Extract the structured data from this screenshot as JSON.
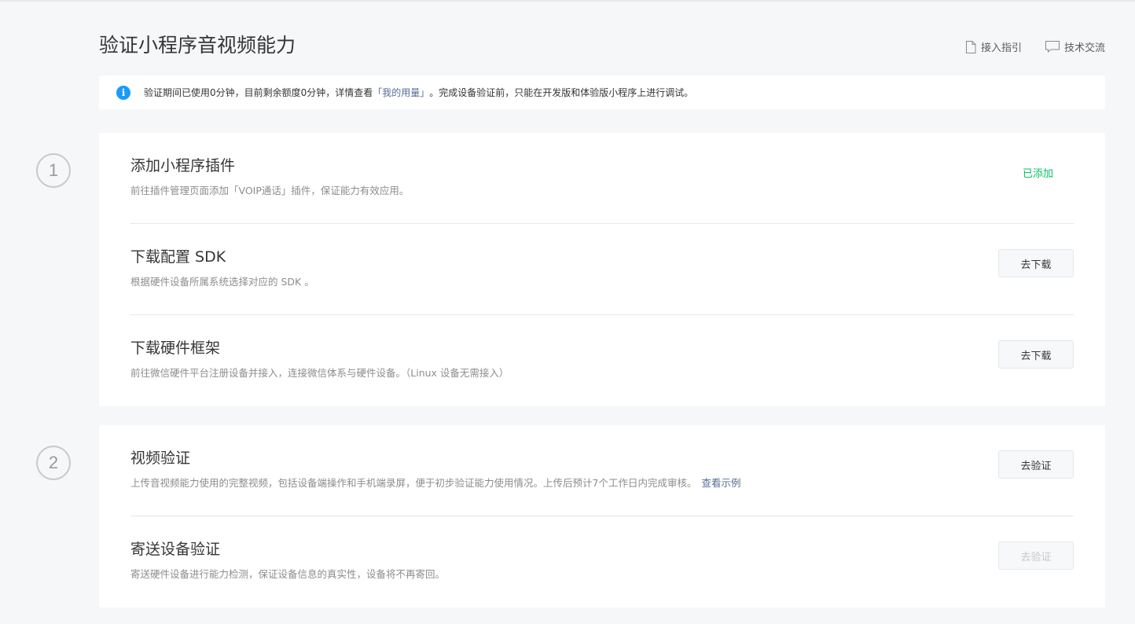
{
  "page": {
    "title": "验证小程序音视频能力"
  },
  "header_links": [
    {
      "label": "接入指引",
      "icon": "document-icon"
    },
    {
      "label": "技术交流",
      "icon": "chat-icon"
    }
  ],
  "notice": {
    "icon": "info-icon",
    "icon_glyph": "i",
    "text_before": "验证期间已使用0分钟，目前剩余额度0分钟，详情查看",
    "link_text": "「我的用量」",
    "text_after": "。完成设备验证前，只能在开发版和体验版小程序上进行调试。"
  },
  "steps": [
    {
      "number": "1",
      "items": [
        {
          "title": "添加小程序插件",
          "desc": "前往插件管理页面添加「VOIP通话」插件，保证能力有效应用。",
          "status": "已添加"
        },
        {
          "title": "下载配置 SDK",
          "desc": "根据硬件设备所属系统选择对应的 SDK 。",
          "button": "去下载"
        },
        {
          "title": "下载硬件框架",
          "desc": "前往微信硬件平台注册设备并接入，连接微信体系与硬件设备。（Linux 设备无需接入）",
          "button": "去下载"
        }
      ]
    },
    {
      "number": "2",
      "items": [
        {
          "title": "视频验证",
          "desc": "上传音视频能力使用的完整视频，包括设备端操作和手机端录屏，便于初步验证能力使用情况。上传后预计7个工作日内完成审核。",
          "link": "查看示例",
          "button": "去验证"
        },
        {
          "title": "寄送设备验证",
          "desc": "寄送硬件设备进行能力检测，保证设备信息的真实性，设备将不再寄回。",
          "button": "去验证",
          "button_disabled": true
        }
      ]
    }
  ],
  "colors": {
    "accent_link": "#576b95",
    "success": "#07c160",
    "info": "#1a9bfc",
    "background": "#f6f7f9"
  }
}
